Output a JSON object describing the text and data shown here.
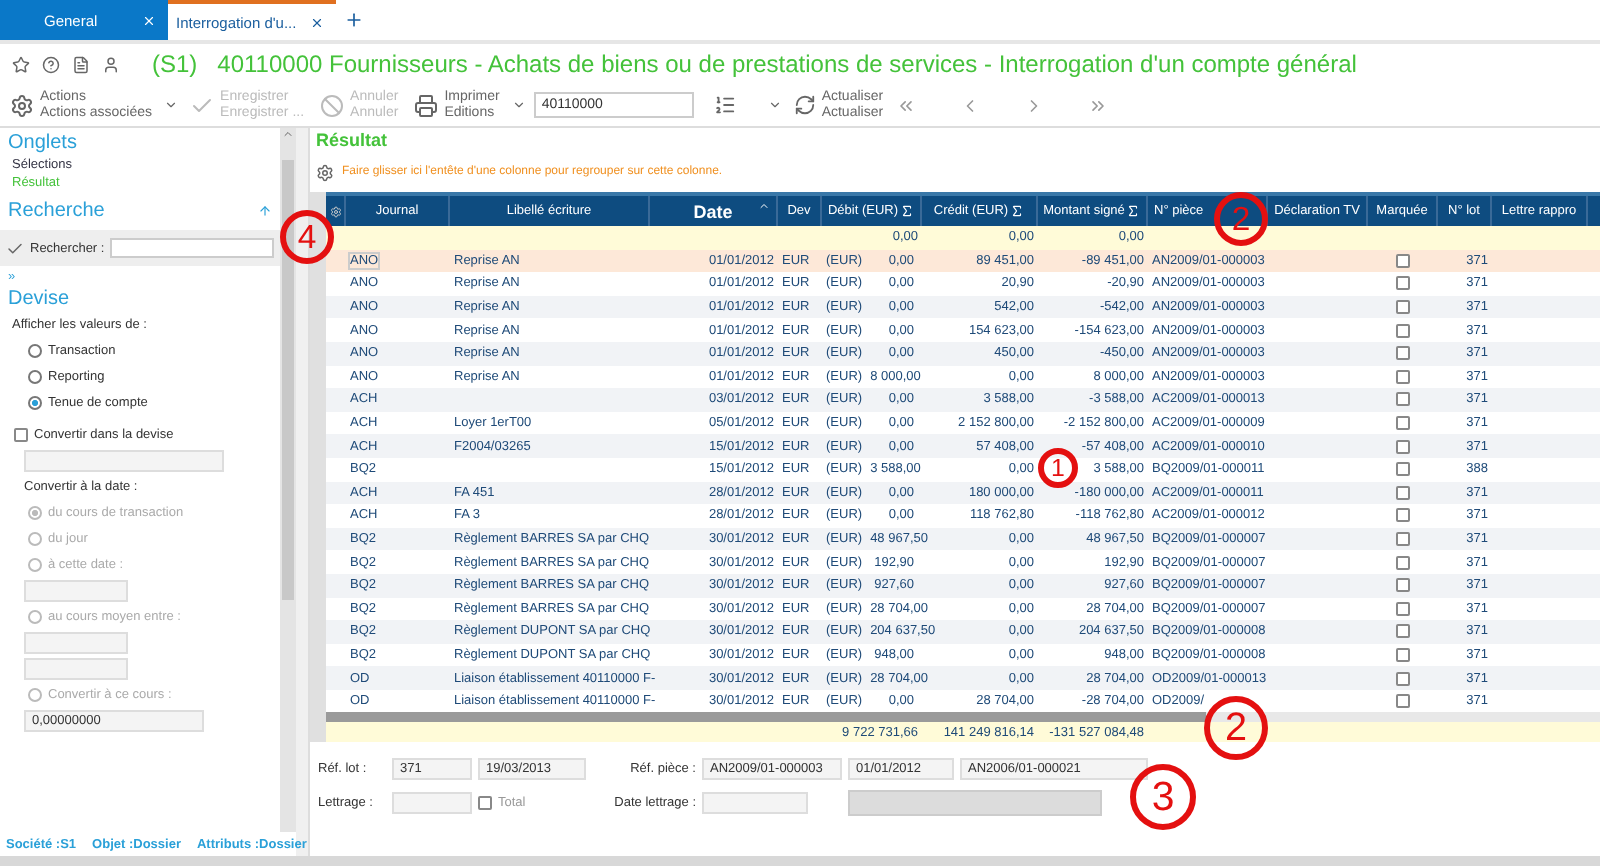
{
  "tabs": [
    {
      "label": "General",
      "selected": false
    },
    {
      "label": "Interrogation d'u...",
      "selected": true
    }
  ],
  "title": {
    "prefix": "(S1)",
    "text": "40110000 Fournisseurs - Achats de biens ou de prestations de services - Interrogation d'un compte général"
  },
  "toolbar": [
    {
      "kind": "actions",
      "label": "Actions",
      "sub": "Actions associées",
      "disabled": false
    },
    {
      "kind": "save",
      "label": "Enregistrer",
      "sub": "Enregistrer ...",
      "disabled": true
    },
    {
      "kind": "cancel",
      "label": "Annuler",
      "sub": "Annuler",
      "disabled": true
    },
    {
      "kind": "print",
      "label": "Imprimer",
      "sub": "Editions",
      "disabled": false
    }
  ],
  "account_field": {
    "value": "40110000"
  },
  "refresh": {
    "label": "Actualiser",
    "sub": "Actualiser"
  },
  "sidebar": {
    "onglets_title": "Onglets",
    "onglets": [
      {
        "label": "Sélections",
        "selected": false
      },
      {
        "label": "Résultat",
        "selected": true
      }
    ],
    "recherche_title": "Recherche",
    "search_label": "Rechercher :",
    "more": "»",
    "devise_title": "Devise",
    "show_label": "Afficher les valeurs de :",
    "value_options": [
      {
        "label": "Transaction",
        "selected": false
      },
      {
        "label": "Reporting",
        "selected": false
      },
      {
        "label": "Tenue de compte",
        "selected": true
      }
    ],
    "convert_check": {
      "label": "Convertir dans la devise",
      "checked": false
    },
    "date_label": "Convertir à la date :",
    "date_options": [
      {
        "label": "du cours de transaction",
        "selected": true,
        "disabled": true
      },
      {
        "label": "du jour",
        "selected": false,
        "disabled": true
      },
      {
        "label": "à cette date :",
        "selected": false,
        "disabled": true
      },
      {
        "label": "au cours moyen entre :",
        "selected": false,
        "disabled": true
      },
      {
        "label": "Convertir à ce cours :",
        "selected": false,
        "disabled": true
      }
    ],
    "rate_value": "0,00000000"
  },
  "status": [
    "Société :S1",
    "Objet :Dossier",
    "Attributs :Dossier"
  ],
  "result_title": "Résultat",
  "group_hint": "Faire glisser ici l'entête d'une colonne pour regrouper sur cette colonne.",
  "columns": [
    {
      "label": "Journal",
      "sum": false
    },
    {
      "label": "Libellé écriture",
      "sum": false
    },
    {
      "label": "Date",
      "sum": false,
      "sorted": true
    },
    {
      "label": "Dev",
      "sum": false
    },
    {
      "label": "Débit (EUR)",
      "sum": true
    },
    {
      "label": "Crédit (EUR)",
      "sum": true
    },
    {
      "label": "Montant signé",
      "sum": true
    },
    {
      "label": "N° pièce",
      "sum": false
    },
    {
      "label": "Déclaration TV",
      "sum": false
    },
    {
      "label": "Marquée",
      "sum": false
    },
    {
      "label": "N° lot",
      "sum": false
    },
    {
      "label": "Lettre rappro",
      "sum": false
    }
  ],
  "sum_row": {
    "debit": "0,00",
    "credit": "0,00",
    "signed": "0,00"
  },
  "rows": [
    {
      "journal": "ANO",
      "label": "Reprise AN",
      "date": "01/01/2012",
      "dev": "EUR",
      "cur": "(EUR)",
      "debit": "0,00",
      "credit": "89 451,00",
      "signed": "-89 451,00",
      "piece": "AN2009/01-000003",
      "marked": false,
      "lot": "371",
      "selected": true
    },
    {
      "journal": "ANO",
      "label": "Reprise AN",
      "date": "01/01/2012",
      "dev": "EUR",
      "cur": "(EUR)",
      "debit": "0,00",
      "credit": "20,90",
      "signed": "-20,90",
      "piece": "AN2009/01-000003",
      "marked": false,
      "lot": "371",
      "selected": false
    },
    {
      "journal": "ANO",
      "label": "Reprise AN",
      "date": "01/01/2012",
      "dev": "EUR",
      "cur": "(EUR)",
      "debit": "0,00",
      "credit": "542,00",
      "signed": "-542,00",
      "piece": "AN2009/01-000003",
      "marked": false,
      "lot": "371",
      "selected": false
    },
    {
      "journal": "ANO",
      "label": "Reprise AN",
      "date": "01/01/2012",
      "dev": "EUR",
      "cur": "(EUR)",
      "debit": "0,00",
      "credit": "154 623,00",
      "signed": "-154 623,00",
      "piece": "AN2009/01-000003",
      "marked": false,
      "lot": "371",
      "selected": false
    },
    {
      "journal": "ANO",
      "label": "Reprise AN",
      "date": "01/01/2012",
      "dev": "EUR",
      "cur": "(EUR)",
      "debit": "0,00",
      "credit": "450,00",
      "signed": "-450,00",
      "piece": "AN2009/01-000003",
      "marked": false,
      "lot": "371",
      "selected": false
    },
    {
      "journal": "ANO",
      "label": "Reprise AN",
      "date": "01/01/2012",
      "dev": "EUR",
      "cur": "(EUR)",
      "debit": "8 000,00",
      "credit": "0,00",
      "signed": "8 000,00",
      "piece": "AN2009/01-000003",
      "marked": false,
      "lot": "371",
      "selected": false
    },
    {
      "journal": "ACH",
      "date": "03/01/2012",
      "dev": "EUR",
      "cur": "(EUR)",
      "debit": "0,00",
      "credit": "3 588,00",
      "signed": "-3 588,00",
      "piece": "AC2009/01-000013",
      "marked": false,
      "lot": "371",
      "selected": false
    },
    {
      "journal": "ACH",
      "label": "Loyer 1erT00",
      "date": "05/01/2012",
      "dev": "EUR",
      "cur": "(EUR)",
      "debit": "0,00",
      "credit": "2 152 800,00",
      "signed": "-2 152 800,00",
      "piece": "AC2009/01-000009",
      "marked": false,
      "lot": "371",
      "selected": false
    },
    {
      "journal": "ACH",
      "label": "F2004/03265",
      "date": "15/01/2012",
      "dev": "EUR",
      "cur": "(EUR)",
      "debit": "0,00",
      "credit": "57 408,00",
      "signed": "-57 408,00",
      "piece": "AC2009/01-000010",
      "marked": false,
      "lot": "371",
      "selected": false
    },
    {
      "journal": "BQ2",
      "date": "15/01/2012",
      "dev": "EUR",
      "cur": "(EUR)",
      "debit": "3 588,00",
      "credit": "0,00",
      "signed": "3 588,00",
      "piece": "BQ2009/01-000011",
      "marked": false,
      "lot": "388",
      "selected": false
    },
    {
      "journal": "ACH",
      "label": "FA 451",
      "date": "28/01/2012",
      "dev": "EUR",
      "cur": "(EUR)",
      "debit": "0,00",
      "credit": "180 000,00",
      "signed": "-180 000,00",
      "piece": "AC2009/01-000011",
      "marked": false,
      "lot": "371",
      "selected": false
    },
    {
      "journal": "ACH",
      "label": "FA 3",
      "date": "28/01/2012",
      "dev": "EUR",
      "cur": "(EUR)",
      "debit": "0,00",
      "credit": "118 762,80",
      "signed": "-118 762,80",
      "piece": "AC2009/01-000012",
      "marked": false,
      "lot": "371",
      "selected": false
    },
    {
      "journal": "BQ2",
      "label": "Règlement BARRES SA par CHQ",
      "date": "30/01/2012",
      "dev": "EUR",
      "cur": "(EUR)",
      "debit": "48 967,50",
      "credit": "0,00",
      "signed": "48 967,50",
      "piece": "BQ2009/01-000007",
      "marked": false,
      "lot": "371",
      "selected": false
    },
    {
      "journal": "BQ2",
      "label": "Règlement BARRES SA par CHQ",
      "date": "30/01/2012",
      "dev": "EUR",
      "cur": "(EUR)",
      "debit": "192,90",
      "credit": "0,00",
      "signed": "192,90",
      "piece": "BQ2009/01-000007",
      "marked": false,
      "lot": "371",
      "selected": false
    },
    {
      "journal": "BQ2",
      "label": "Règlement BARRES SA par CHQ",
      "date": "30/01/2012",
      "dev": "EUR",
      "cur": "(EUR)",
      "debit": "927,60",
      "credit": "0,00",
      "signed": "927,60",
      "piece": "BQ2009/01-000007",
      "marked": false,
      "lot": "371",
      "selected": false
    },
    {
      "journal": "BQ2",
      "label": "Règlement BARRES SA par CHQ",
      "date": "30/01/2012",
      "dev": "EUR",
      "cur": "(EUR)",
      "debit": "28 704,00",
      "credit": "0,00",
      "signed": "28 704,00",
      "piece": "BQ2009/01-000007",
      "marked": false,
      "lot": "371",
      "selected": false
    },
    {
      "journal": "BQ2",
      "label": "Règlement DUPONT SA par CHQ",
      "date": "30/01/2012",
      "dev": "EUR",
      "cur": "(EUR)",
      "debit": "204 637,50",
      "credit": "0,00",
      "signed": "204 637,50",
      "piece": "BQ2009/01-000008",
      "marked": false,
      "lot": "371",
      "selected": false
    },
    {
      "journal": "BQ2",
      "label": "Règlement DUPONT SA par CHQ",
      "date": "30/01/2012",
      "dev": "EUR",
      "cur": "(EUR)",
      "debit": "948,00",
      "credit": "0,00",
      "signed": "948,00",
      "piece": "BQ2009/01-000008",
      "marked": false,
      "lot": "371",
      "selected": false
    },
    {
      "journal": "OD",
      "label": "Liaison établissement 40110000 F-",
      "date": "30/01/2012",
      "dev": "EUR",
      "cur": "(EUR)",
      "debit": "28 704,00",
      "credit": "0,00",
      "signed": "28 704,00",
      "piece": "OD2009/01-000013",
      "marked": false,
      "lot": "371",
      "selected": false
    },
    {
      "journal": "OD",
      "label": "Liaison établissement 40110000 F-",
      "date": "30/01/2012",
      "dev": "EUR",
      "cur": "(EUR)",
      "debit": "0,00",
      "credit": "28 704,00",
      "signed": "-28 704,00",
      "piece": "OD2009/",
      "marked": false,
      "lot": "371",
      "selected": false
    }
  ],
  "totals": {
    "debit": "9 722 731,66",
    "credit": "141 249 816,14",
    "signed": "-131 527 084,48"
  },
  "detail": {
    "lot_label": "Réf. lot :",
    "lot": "371",
    "lot_date": "19/03/2013",
    "piece_label": "Réf. pièce :",
    "piece": "AN2009/01-000003",
    "piece_date": "01/01/2012",
    "piece_ref": "AN2006/01-000021",
    "lettrage_label": "Lettrage :",
    "total": {
      "label": "Total",
      "checked": false
    },
    "date_lettrage_label": "Date lettrage :"
  },
  "callouts": [
    {
      "text": "4"
    },
    {
      "text": "2"
    },
    {
      "text": "1"
    },
    {
      "text": "2"
    },
    {
      "text": "3"
    }
  ]
}
